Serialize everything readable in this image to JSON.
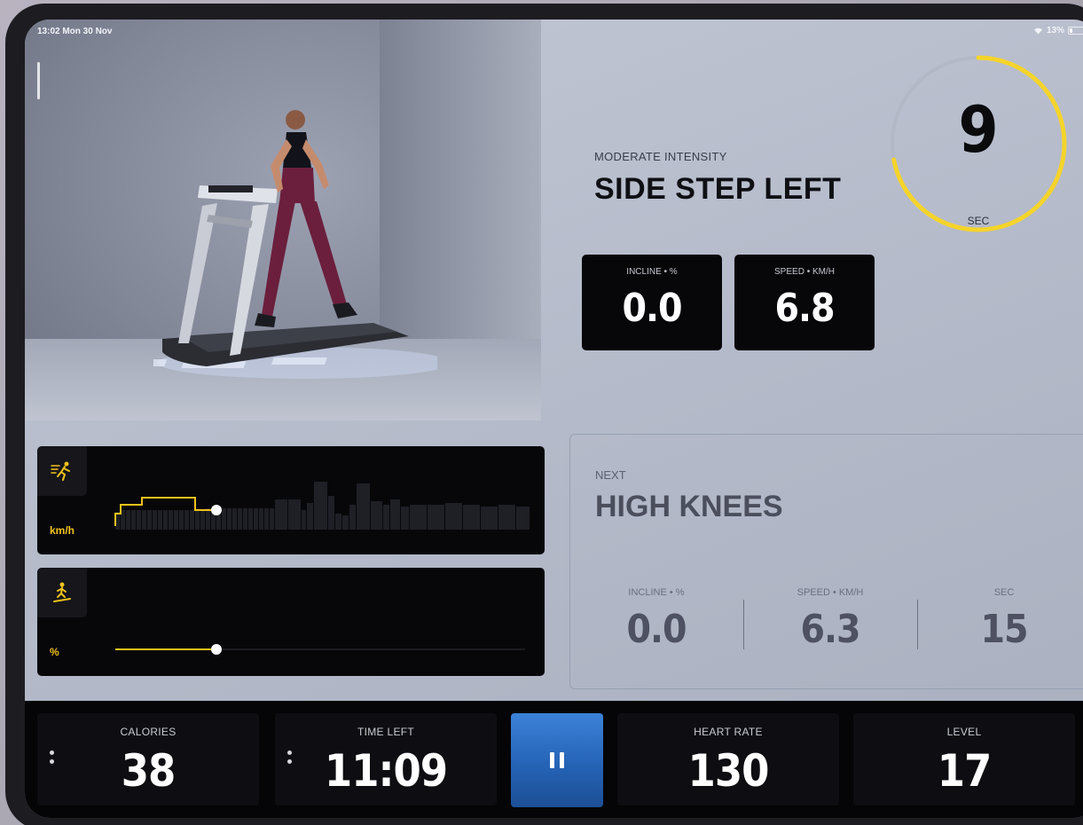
{
  "status_bar": {
    "time_date": "13:02  Mon 30 Nov",
    "battery": "13%"
  },
  "workout": {
    "intensity": "MODERATE INTENSITY",
    "exercise": "SIDE STEP LEFT",
    "timer": {
      "value": "9",
      "unit": "SEC",
      "remaining_fraction": 0.72
    },
    "incline": {
      "label": "INCLINE • %",
      "value": "0.0"
    },
    "speed": {
      "label": "SPEED • KM/H",
      "value": "6.8"
    }
  },
  "speed_chart": {
    "unit": "km/h",
    "icon": "runner-speed-icon"
  },
  "incline_chart": {
    "unit": "%",
    "icon": "incline-walker-icon"
  },
  "next": {
    "label": "NEXT",
    "exercise": "HIGH KNEES",
    "incline": {
      "label": "INCLINE • %",
      "value": "0.0"
    },
    "speed": {
      "label": "SPEED • KM/H",
      "value": "6.3"
    },
    "duration": {
      "label": "SEC",
      "value": "15"
    }
  },
  "bottom": {
    "calories": {
      "label": "CALORIES",
      "value": "38"
    },
    "time_left": {
      "label": "TIME LEFT",
      "value": "11:09"
    },
    "heart_rate": {
      "label": "HEART RATE",
      "value": "130"
    },
    "level": {
      "label": "LEVEL",
      "value": "17"
    }
  },
  "colors": {
    "accent": "#f1c21b",
    "pause": "#2d6fc4",
    "panel": "#07070a"
  }
}
